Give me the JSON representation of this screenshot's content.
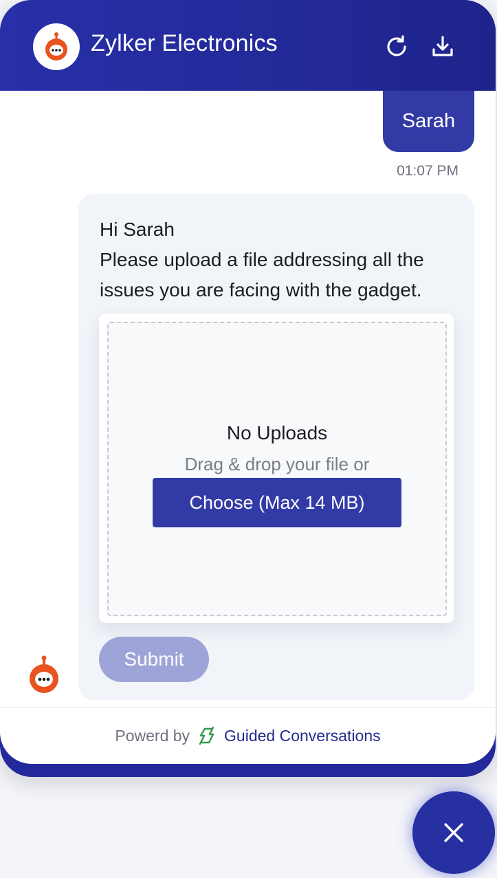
{
  "header": {
    "title": "Zylker Electronics",
    "refresh_icon": "refresh-icon",
    "download_icon": "download-icon",
    "logo_icon": "robot-chat-icon"
  },
  "conversation": {
    "user_message": "Sarah",
    "user_timestamp": "01:07 PM",
    "bot_greeting": "Hi Sarah",
    "bot_message": "Please upload a file addressing all the issues you are facing with the gadget."
  },
  "upload": {
    "status": "No Uploads",
    "hint": "Drag & drop your file or",
    "choose_label": "Choose (Max 14 MB)"
  },
  "submit_label": "Submit",
  "footer": {
    "powered_by": "Powerd by",
    "brand": "Guided Conversations",
    "brand_icon": "guided-conversations-logo-icon"
  },
  "fab": {
    "icon": "close-icon"
  },
  "colors": {
    "header": "#2730a8",
    "accent": "#323aa6",
    "bot_icon": "#e8531f",
    "submit_disabled": "#9ea4d8",
    "brand_green": "#2e9a4a"
  }
}
